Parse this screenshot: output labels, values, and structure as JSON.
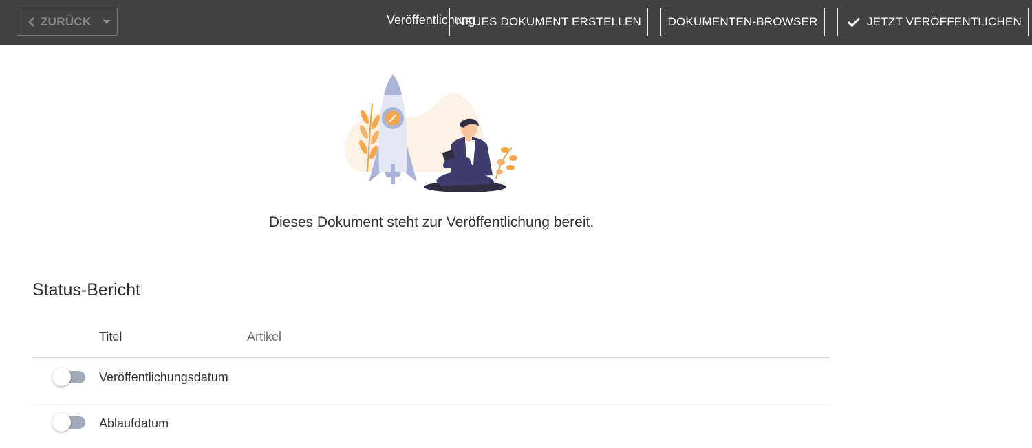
{
  "toolbar": {
    "back_label": "ZURÜCK",
    "page_title": "Veröffentlichung",
    "new_document_label": "NEUES DOKUMENT ERSTELLEN",
    "browser_label": "DOKUMENTEN-BROWSER",
    "publish_label": "JETZT VERÖFFENTLICHEN"
  },
  "main": {
    "ready_message": "Dieses Dokument steht zur Veröffentlichung bereit."
  },
  "status_report": {
    "title": "Status-Bericht",
    "rows": [
      {
        "label": "Titel",
        "value": "Artikel"
      },
      {
        "label": "Veröffentlichungsdatum",
        "toggle_on": false
      },
      {
        "label": "Ablaufdatum",
        "toggle_on": false
      }
    ]
  },
  "colors": {
    "topbar": "#424242",
    "toggle_track": "#a2a9b8",
    "illustration_rocket": "#dfe3f0",
    "illustration_accent": "#f4a64a",
    "illustration_person": "#3f3d6e"
  }
}
